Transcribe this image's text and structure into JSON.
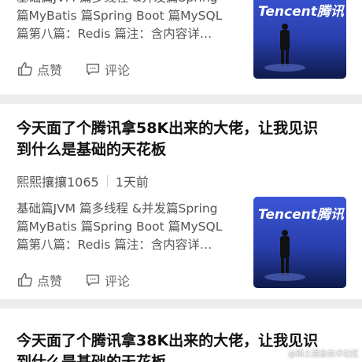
{
  "articles": [
    {
      "excerpt_lines": [
        "基础篇JVM 篇多线程 &并发篇Spring",
        "篇MyBatis 篇Spring Boot 篇MySQL",
        "篇第八篇：Redis 篇注：含内容详…"
      ],
      "thumbnail_logo": "Tencent腾讯",
      "like_label": "点赞",
      "comment_label": "评论"
    },
    {
      "title_lines": [
        "今天面了个腾讯拿58K出来的大佬，让我见识",
        "到什么是基础的天花板"
      ],
      "author": "熙熙攘攘1065",
      "time": "1天前",
      "excerpt_lines": [
        "基础篇JVM 篇多线程 &并发篇Spring",
        "篇MyBatis 篇Spring Boot 篇MySQL",
        "篇第八篇：Redis 篇注：含内容详…"
      ],
      "thumbnail_logo": "Tencent腾讯",
      "like_label": "点赞",
      "comment_label": "评论"
    },
    {
      "title_lines": [
        "今天面了个腾讯拿38K出来的大佬，让我见识",
        "到什么是基础的天花板"
      ]
    }
  ],
  "watermark": "@稀土掘金技术社区",
  "colors": {
    "thumb_bg": "#2a3fae",
    "thumb_floor": "#0d1a4a",
    "icon": "#666666"
  }
}
